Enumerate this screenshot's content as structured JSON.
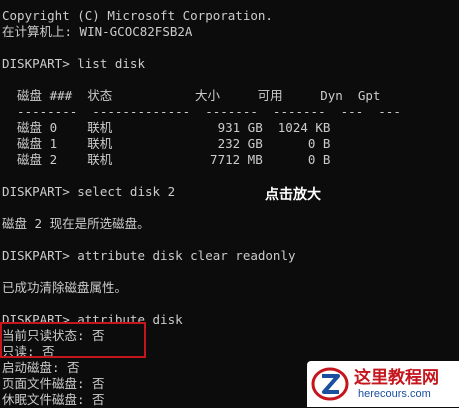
{
  "console": {
    "lines": [
      "Copyright (C) Microsoft Corporation.",
      "在计算机上: WIN-GCOC82FSB2A",
      "",
      "DISKPART> list disk",
      "",
      "  磁盘 ###  状态           大小     可用     Dyn  Gpt",
      "  --------  -------------  -------  -------  ---  ---",
      "  磁盘 0    联机              931 GB  1024 KB",
      "  磁盘 1    联机              232 GB      0 B",
      "  磁盘 2    联机             7712 MB      0 B",
      "",
      "DISKPART> select disk 2",
      "",
      "磁盘 2 现在是所选磁盘。",
      "",
      "DISKPART> attribute disk clear readonly",
      "",
      "已成功清除磁盘属性。",
      "",
      "DISKPART> attribute disk",
      "当前只读状态: 否",
      "只读: 否",
      "启动磁盘: 否",
      "页面文件磁盘: 否",
      "休眠文件磁盘: 否"
    ]
  },
  "annotation": {
    "hint": "点击放大",
    "box_color": "#c4161c"
  },
  "watermark": {
    "title": "这里教程网",
    "url": "herecours.com",
    "icon": "z-logo-icon"
  },
  "colors": {
    "background": "#0c0c0c",
    "text": "#cccccc"
  }
}
